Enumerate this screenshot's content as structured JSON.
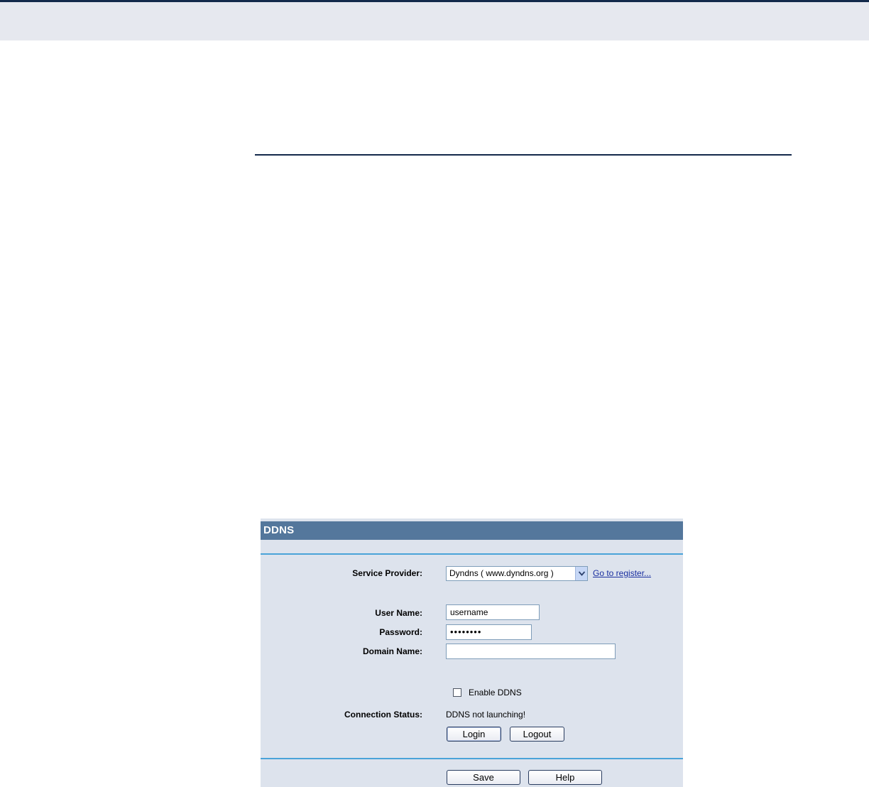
{
  "ddns": {
    "title": "DDNS",
    "service_provider": {
      "label": "Service Provider:",
      "selected": "Dyndns ( www.dyndns.org )",
      "register_link": "Go to register..."
    },
    "user_name": {
      "label": "User Name:",
      "value": "username"
    },
    "password": {
      "label": "Password:",
      "value": "••••••••"
    },
    "domain_name": {
      "label": "Domain Name:",
      "value": ""
    },
    "enable_ddns": {
      "label": "Enable DDNS",
      "checked": false
    },
    "connection_status": {
      "label": "Connection Status:",
      "value": "DDNS not launching!"
    },
    "buttons": {
      "login": "Login",
      "logout": "Logout",
      "save": "Save",
      "help": "Help"
    }
  },
  "colors": {
    "header_band": "#e6e8ef",
    "header_rule": "#13294b",
    "panel_bg": "#dde3ed",
    "panel_title_bg": "#54779c",
    "panel_rule": "#4aa3d9",
    "link": "#1a2fa0"
  }
}
